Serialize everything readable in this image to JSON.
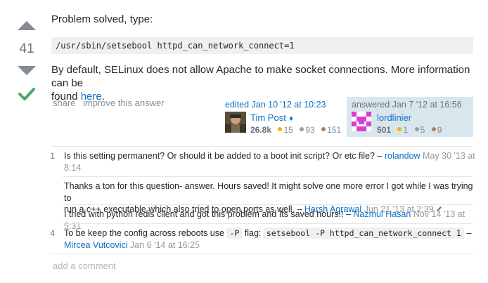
{
  "vote": {
    "count": "41"
  },
  "post": {
    "intro": "Problem solved, type:",
    "code": "/usr/sbin/setsebool httpd_can_network_connect=1",
    "body_line1": "By default, SELinux does not allow Apache to make socket connections. More information can be",
    "body_line2_prefix": "found ",
    "body_link": "here",
    "body_line2_suffix": "."
  },
  "menu": {
    "share": "share",
    "improve": "improve this answer"
  },
  "editor": {
    "action": "edited Jan 10 '12 at 10:23",
    "name": "Tim Post",
    "diamond": "♦",
    "rep": "26.8k",
    "gold": "15",
    "silver": "93",
    "bronze": "151"
  },
  "owner": {
    "action": "answered Jan 7 '12 at 16:56",
    "name": "lordlinier",
    "rep": "501",
    "gold": "1",
    "silver": "5",
    "bronze": "9"
  },
  "comments": [
    {
      "score": "1",
      "text": "Is this setting permanent? Or should it be added to a boot init script? Or etc file? –",
      "user": "rolandow",
      "date_a": "May 30 '13 at",
      "date_b": "8:14"
    },
    {
      "score": "",
      "text_line1": "Thanks a ton for this question- answer. Hours saved! It might solve one more error I got while I was trying to",
      "text_line2": "run a c++ executable which also tried to open ports as well. –",
      "user": "Harsh Agrawal",
      "date": "Jun 21 '13 at 2:39"
    },
    {
      "score": "",
      "text": "I tried with python redis client and got this problem and Its saved hours!! –",
      "user": "Nazmul Hasan",
      "date": "Nov 14 '13 at 5:31"
    },
    {
      "score": "4",
      "text_a": "To be keep the config across reboots use",
      "code_a": "-P",
      "text_b": "flag:",
      "code_b": "setsebool -P httpd_can_network_connect 1",
      "text_c": "–",
      "user": "Mircea Vutcovici",
      "date": "Jan 6 '14 at 16:25"
    }
  ],
  "add_comment": "add a comment",
  "colors": {
    "link": "#0a70c4",
    "accepted": "#48a868",
    "owner_bg": "#d9e6ee"
  }
}
